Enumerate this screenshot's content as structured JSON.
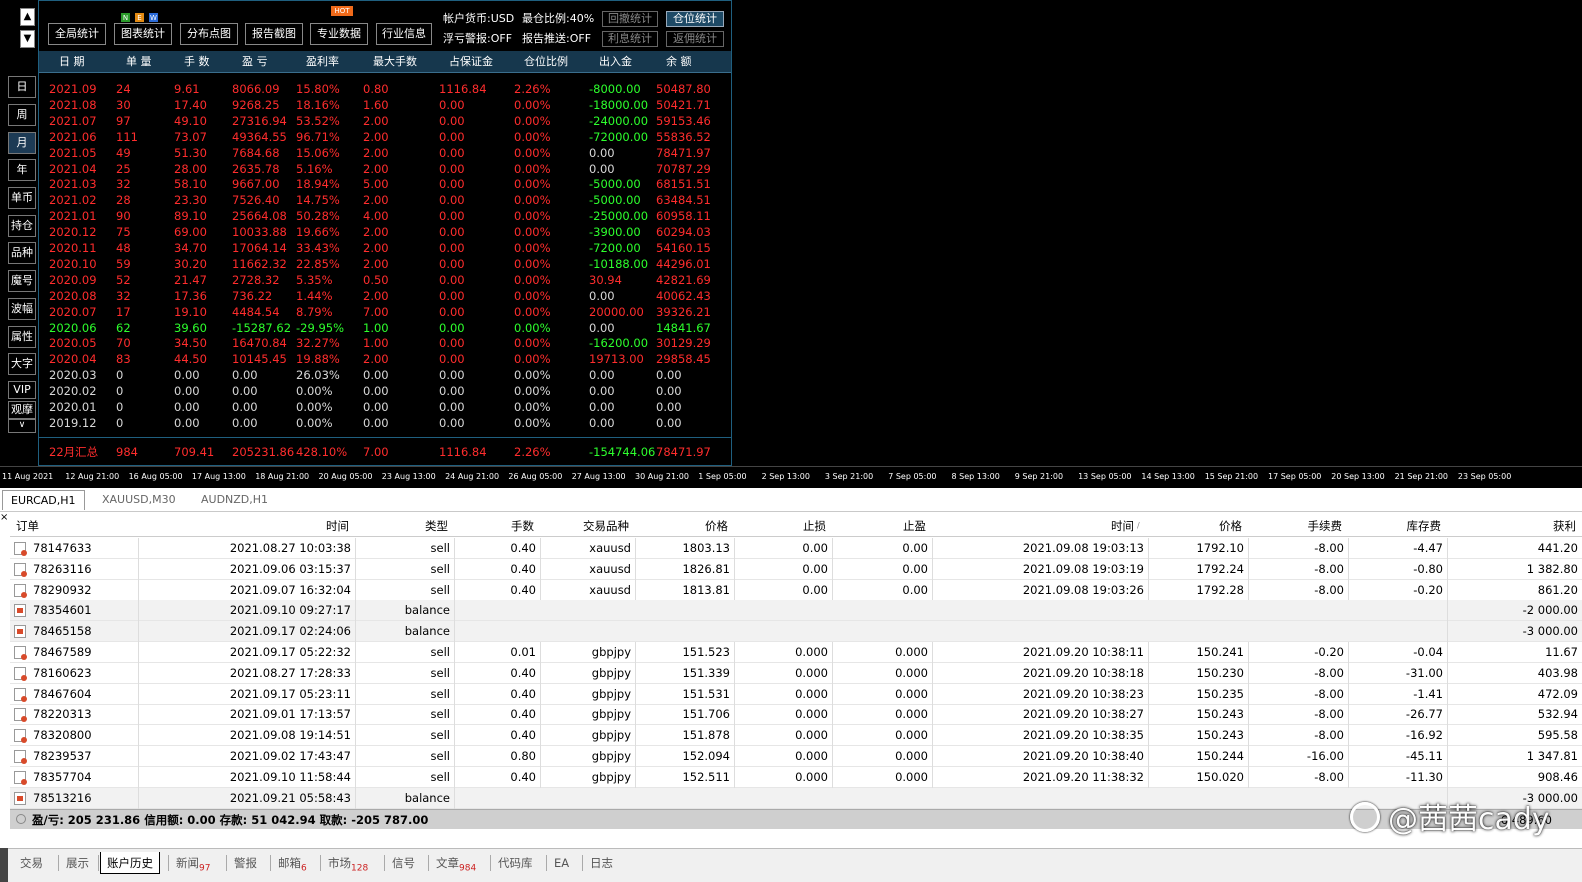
{
  "nav": {
    "up": "▲",
    "down": "▼",
    "buttons": [
      "日",
      "周",
      "月",
      "年",
      "单币",
      "持仓",
      "品种",
      "魔号",
      "波幅",
      "属性",
      "大字",
      "VIP",
      "观摩",
      "∨"
    ]
  },
  "toolbar": {
    "buttons": [
      "全局统计",
      "图表统计",
      "分布点图",
      "报告截图",
      "专业数据",
      "行业信息"
    ],
    "badges": {
      "n": "N",
      "e": "E",
      "w": "W",
      "hot": "HOT"
    },
    "account_currency": "帐户货币:USD",
    "max_position_ratio": "最仓比例:40%",
    "float_alert": "浮亏警报:OFF",
    "report_push": "报告推送:OFF",
    "stat_buttons": [
      "回撤统计",
      "仓位统计",
      "利息统计",
      "返佣统计"
    ]
  },
  "stats": {
    "headers": [
      "日 期",
      "单 量",
      "手 数",
      "盈 亏",
      "盈利率",
      "最大手数",
      "占保证金",
      "仓位比例",
      "出入金",
      "余 额"
    ],
    "rows": [
      {
        "c": "red",
        "v": [
          "2021.09",
          "24",
          "9.61",
          "8066.09",
          "15.80%",
          "0.80",
          "1116.84",
          "2.26%",
          "-8000.00",
          "50487.80"
        ],
        "dep": "green"
      },
      {
        "c": "red",
        "v": [
          "2021.08",
          "30",
          "17.40",
          "9268.25",
          "18.16%",
          "1.60",
          "0.00",
          "0.00%",
          "-18000.00",
          "50421.71"
        ],
        "dep": "green"
      },
      {
        "c": "red",
        "v": [
          "2021.07",
          "97",
          "49.10",
          "27316.94",
          "53.52%",
          "2.00",
          "0.00",
          "0.00%",
          "-24000.00",
          "59153.46"
        ],
        "dep": "green"
      },
      {
        "c": "red",
        "v": [
          "2021.06",
          "111",
          "73.07",
          "49364.55",
          "96.71%",
          "2.00",
          "0.00",
          "0.00%",
          "-72000.00",
          "55836.52"
        ],
        "dep": "green"
      },
      {
        "c": "red",
        "v": [
          "2021.05",
          "49",
          "51.30",
          "7684.68",
          "15.06%",
          "2.00",
          "0.00",
          "0.00%",
          "0.00",
          "78471.97"
        ],
        "dep": "gray"
      },
      {
        "c": "red",
        "v": [
          "2021.04",
          "25",
          "28.00",
          "2635.78",
          "5.16%",
          "2.00",
          "0.00",
          "0.00%",
          "0.00",
          "70787.29"
        ],
        "dep": "gray"
      },
      {
        "c": "red",
        "v": [
          "2021.03",
          "32",
          "58.10",
          "9667.00",
          "18.94%",
          "5.00",
          "0.00",
          "0.00%",
          "-5000.00",
          "68151.51"
        ],
        "dep": "green"
      },
      {
        "c": "red",
        "v": [
          "2021.02",
          "28",
          "23.30",
          "7526.40",
          "14.75%",
          "2.00",
          "0.00",
          "0.00%",
          "-5000.00",
          "63484.51"
        ],
        "dep": "green"
      },
      {
        "c": "red",
        "v": [
          "2021.01",
          "90",
          "89.10",
          "25664.08",
          "50.28%",
          "4.00",
          "0.00",
          "0.00%",
          "-25000.00",
          "60958.11"
        ],
        "dep": "green"
      },
      {
        "c": "red",
        "v": [
          "2020.12",
          "75",
          "69.00",
          "10033.88",
          "19.66%",
          "2.00",
          "0.00",
          "0.00%",
          "-3900.00",
          "60294.03"
        ],
        "dep": "green"
      },
      {
        "c": "red",
        "v": [
          "2020.11",
          "48",
          "34.70",
          "17064.14",
          "33.43%",
          "2.00",
          "0.00",
          "0.00%",
          "-7200.00",
          "54160.15"
        ],
        "dep": "green"
      },
      {
        "c": "red",
        "v": [
          "2020.10",
          "59",
          "30.20",
          "11662.32",
          "22.85%",
          "2.00",
          "0.00",
          "0.00%",
          "-10188.00",
          "44296.01"
        ],
        "dep": "green"
      },
      {
        "c": "red",
        "v": [
          "2020.09",
          "52",
          "21.47",
          "2728.32",
          "5.35%",
          "0.50",
          "0.00",
          "0.00%",
          "30.94",
          "42821.69"
        ],
        "dep": "red"
      },
      {
        "c": "red",
        "v": [
          "2020.08",
          "32",
          "17.36",
          "736.22",
          "1.44%",
          "2.00",
          "0.00",
          "0.00%",
          "0.00",
          "40062.43"
        ],
        "dep": "gray"
      },
      {
        "c": "red",
        "v": [
          "2020.07",
          "17",
          "19.10",
          "4484.54",
          "8.79%",
          "7.00",
          "0.00",
          "0.00%",
          "20000.00",
          "39326.21"
        ],
        "dep": "red"
      },
      {
        "c": "green",
        "v": [
          "2020.06",
          "62",
          "39.60",
          "-15287.62",
          "-29.95%",
          "1.00",
          "0.00",
          "0.00%",
          "0.00",
          "14841.67"
        ],
        "dep": "gray"
      },
      {
        "c": "red",
        "v": [
          "2020.05",
          "70",
          "34.50",
          "16470.84",
          "32.27%",
          "1.00",
          "0.00",
          "0.00%",
          "-16200.00",
          "30129.29"
        ],
        "dep": "green"
      },
      {
        "c": "red",
        "v": [
          "2020.04",
          "83",
          "44.50",
          "10145.45",
          "19.88%",
          "2.00",
          "0.00",
          "0.00%",
          "19713.00",
          "29858.45"
        ],
        "dep": "red"
      },
      {
        "c": "gray",
        "v": [
          "2020.03",
          "0",
          "0.00",
          "0.00",
          "26.03%",
          "0.00",
          "0.00",
          "0.00%",
          "0.00",
          "0.00"
        ],
        "dep": "gray"
      },
      {
        "c": "gray",
        "v": [
          "2020.02",
          "0",
          "0.00",
          "0.00",
          "0.00%",
          "0.00",
          "0.00",
          "0.00%",
          "0.00",
          "0.00"
        ],
        "dep": "gray"
      },
      {
        "c": "gray",
        "v": [
          "2020.01",
          "0",
          "0.00",
          "0.00",
          "0.00%",
          "0.00",
          "0.00",
          "0.00%",
          "0.00",
          "0.00"
        ],
        "dep": "gray"
      },
      {
        "c": "gray",
        "v": [
          "2019.12",
          "0",
          "0.00",
          "0.00",
          "0.00%",
          "0.00",
          "0.00",
          "0.00%",
          "0.00",
          "0.00"
        ],
        "dep": "gray"
      }
    ],
    "total": [
      "22月汇总",
      "984",
      "709.41",
      "205231.86",
      "428.10%",
      "7.00",
      "1116.84",
      "2.26%",
      "-154744.06",
      "78471.97"
    ]
  },
  "axis": [
    "11 Aug 2021",
    "12 Aug 21:00",
    "16 Aug 05:00",
    "17 Aug 13:00",
    "18 Aug 21:00",
    "20 Aug 05:00",
    "23 Aug 13:00",
    "24 Aug 21:00",
    "26 Aug 05:00",
    "27 Aug 13:00",
    "30 Aug 21:00",
    "1 Sep 05:00",
    "2 Sep 13:00",
    "3 Sep 21:00",
    "7 Sep 05:00",
    "8 Sep 13:00",
    "9 Sep 21:00",
    "13 Sep 05:00",
    "14 Sep 13:00",
    "15 Sep 21:00",
    "17 Sep 05:00",
    "20 Sep 13:00",
    "21 Sep 21:00",
    "23 Sep 05:00"
  ],
  "chart_tabs": [
    "EURCAD,H1",
    "XAUUSD,M30",
    "AUDNZD,H1"
  ],
  "history": {
    "headers": [
      "订单",
      "时间",
      "类型",
      "手数",
      "交易品种",
      "价格",
      "止损",
      "止盈",
      "时间",
      "价格",
      "手续费",
      "库存费",
      "获利"
    ],
    "sort_mark": "/",
    "rows": [
      {
        "k": "t",
        "v": [
          "78147633",
          "2021.08.27 10:03:38",
          "sell",
          "0.40",
          "xauusd",
          "1803.13",
          "0.00",
          "0.00",
          "2021.09.08 19:03:13",
          "1792.10",
          "-8.00",
          "-4.47",
          "441.20"
        ]
      },
      {
        "k": "t",
        "v": [
          "78263116",
          "2021.09.06 03:15:37",
          "sell",
          "0.40",
          "xauusd",
          "1826.81",
          "0.00",
          "0.00",
          "2021.09.08 19:03:19",
          "1792.24",
          "-8.00",
          "-0.80",
          "1 382.80"
        ]
      },
      {
        "k": "t",
        "v": [
          "78290932",
          "2021.09.07 16:32:04",
          "sell",
          "0.40",
          "xauusd",
          "1813.81",
          "0.00",
          "0.00",
          "2021.09.08 19:03:26",
          "1792.28",
          "-8.00",
          "-0.20",
          "861.20"
        ]
      },
      {
        "k": "b",
        "v": [
          "78354601",
          "2021.09.10 09:27:17",
          "balance",
          "",
          "",
          "",
          "",
          "",
          "",
          "",
          "",
          "",
          "-2 000.00"
        ]
      },
      {
        "k": "b",
        "v": [
          "78465158",
          "2021.09.17 02:24:06",
          "balance",
          "",
          "",
          "",
          "",
          "",
          "",
          "",
          "",
          "",
          "-3 000.00"
        ]
      },
      {
        "k": "t",
        "v": [
          "78467589",
          "2021.09.17 05:22:32",
          "sell",
          "0.01",
          "gbpjpy",
          "151.523",
          "0.000",
          "0.000",
          "2021.09.20 10:38:11",
          "150.241",
          "-0.20",
          "-0.04",
          "11.67"
        ]
      },
      {
        "k": "t",
        "v": [
          "78160623",
          "2021.08.27 17:28:33",
          "sell",
          "0.40",
          "gbpjpy",
          "151.339",
          "0.000",
          "0.000",
          "2021.09.20 10:38:18",
          "150.230",
          "-8.00",
          "-31.00",
          "403.98"
        ]
      },
      {
        "k": "t",
        "v": [
          "78467604",
          "2021.09.17 05:23:11",
          "sell",
          "0.40",
          "gbpjpy",
          "151.531",
          "0.000",
          "0.000",
          "2021.09.20 10:38:23",
          "150.235",
          "-8.00",
          "-1.41",
          "472.09"
        ]
      },
      {
        "k": "t",
        "v": [
          "78220313",
          "2021.09.01 17:13:57",
          "sell",
          "0.40",
          "gbpjpy",
          "151.706",
          "0.000",
          "0.000",
          "2021.09.20 10:38:27",
          "150.243",
          "-8.00",
          "-26.77",
          "532.94"
        ]
      },
      {
        "k": "t",
        "v": [
          "78320800",
          "2021.09.08 19:14:51",
          "sell",
          "0.40",
          "gbpjpy",
          "151.878",
          "0.000",
          "0.000",
          "2021.09.20 10:38:35",
          "150.243",
          "-8.00",
          "-16.92",
          "595.58"
        ]
      },
      {
        "k": "t",
        "v": [
          "78239537",
          "2021.09.02 17:43:47",
          "sell",
          "0.80",
          "gbpjpy",
          "152.094",
          "0.000",
          "0.000",
          "2021.09.20 10:38:40",
          "150.244",
          "-16.00",
          "-45.11",
          "1 347.81"
        ]
      },
      {
        "k": "t",
        "v": [
          "78357704",
          "2021.09.10 11:58:44",
          "sell",
          "0.40",
          "gbpjpy",
          "152.511",
          "0.000",
          "0.000",
          "2021.09.20 11:38:32",
          "150.020",
          "-8.00",
          "-11.30",
          "908.46"
        ]
      },
      {
        "k": "b",
        "v": [
          "78513216",
          "2021.09.21 05:58:43",
          "balance",
          "",
          "",
          "",
          "",
          "",
          "",
          "",
          "",
          "",
          "-3 000.00"
        ]
      }
    ],
    "footer": "盈/亏: 205 231.86  信用额: 0.00  存款: 51 042.94  取款: -205 787.00",
    "footer_right": "6 489.60"
  },
  "bottom_tabs": [
    {
      "label": "交易",
      "count": ""
    },
    {
      "label": "展示",
      "count": ""
    },
    {
      "label": "账户历史",
      "count": ""
    },
    {
      "label": "新闻",
      "count": "97"
    },
    {
      "label": "警报",
      "count": ""
    },
    {
      "label": "邮箱",
      "count": "6"
    },
    {
      "label": "市场",
      "count": "128"
    },
    {
      "label": "信号",
      "count": ""
    },
    {
      "label": "文章",
      "count": "984"
    },
    {
      "label": "代码库",
      "count": ""
    },
    {
      "label": "EA",
      "count": ""
    },
    {
      "label": "日志",
      "count": ""
    }
  ],
  "watermark": "@茜茜cady",
  "colors": {
    "profit": "#ff2d2d",
    "loss": "#2dff2d",
    "header_bg": "#16374d",
    "panel_border": "#1f5f7f"
  }
}
